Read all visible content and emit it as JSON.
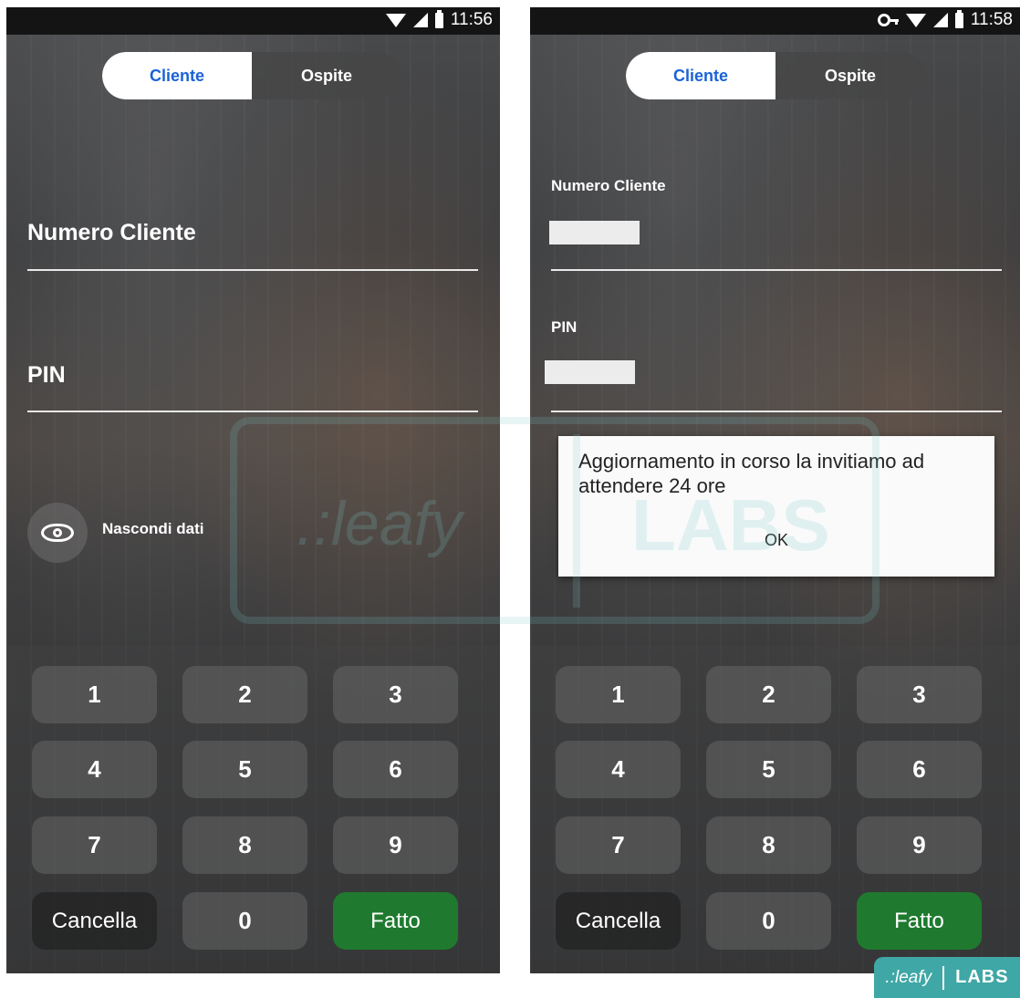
{
  "left": {
    "status_time": "11:56",
    "tabs": [
      "Cliente",
      "Ospite"
    ],
    "customer_number_label": "Numero Cliente",
    "pin_label": "PIN",
    "hide_data_label": "Nascondi dati",
    "keys": [
      "1",
      "2",
      "3",
      "4",
      "5",
      "6",
      "7",
      "8",
      "9"
    ],
    "cancel_label": "Cancella",
    "zero_label": "0",
    "done_label": "Fatto"
  },
  "right": {
    "status_time": "11:58",
    "tabs": [
      "Cliente",
      "Ospite"
    ],
    "customer_number_label": "Numero Cliente",
    "pin_label": "PIN",
    "dialog_message": "Aggiornamento in corso la invitiamo ad attendere 24 ore",
    "dialog_ok": "OK",
    "keys": [
      "1",
      "2",
      "3",
      "4",
      "5",
      "6",
      "7",
      "8",
      "9"
    ],
    "cancel_label": "Cancella",
    "zero_label": "0",
    "done_label": "Fatto"
  },
  "watermark": {
    "brand": ".:leafy",
    "labs": "LABS"
  },
  "colors": {
    "accent_blue": "#1a63d6",
    "done_green": "#1f7a2f",
    "badge_teal": "#3fa7a5"
  }
}
